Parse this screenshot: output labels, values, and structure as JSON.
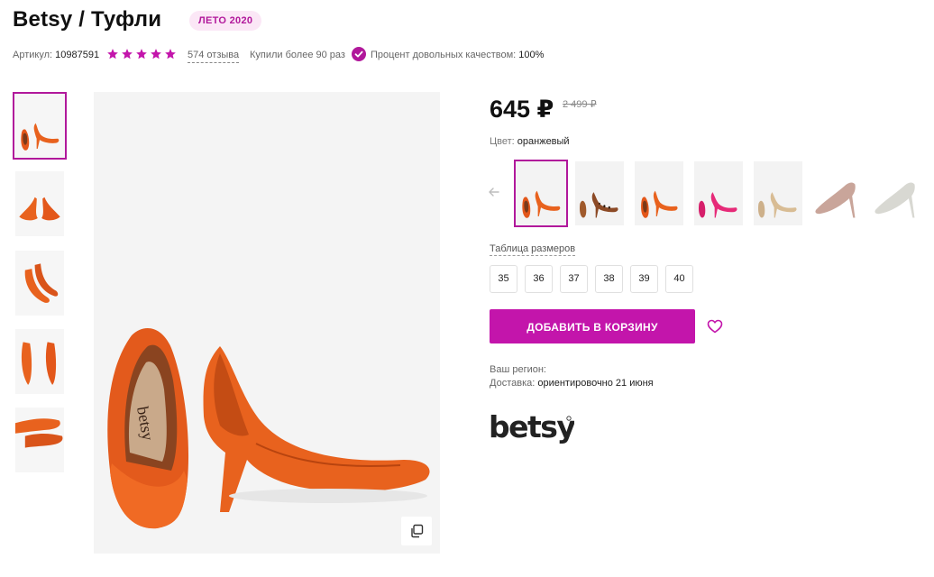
{
  "product": {
    "title": "Betsy / Туфли",
    "badge": "ЛЕТО 2020"
  },
  "meta": {
    "article_label": "Артикул:",
    "article_value": "10987591",
    "rating_stars": 5,
    "reviews": "574 отзыва",
    "purchases": "Купили более 90 раз",
    "quality_label": "Процент довольных качеством:",
    "quality_value": "100%"
  },
  "price": {
    "current": "645 ₽",
    "old": "2 499 ₽"
  },
  "color": {
    "label": "Цвет:",
    "value": "оранжевый"
  },
  "swatches": [
    {
      "color": "orange",
      "selected": true
    },
    {
      "color": "leopard",
      "selected": false
    },
    {
      "color": "orange",
      "selected": false
    },
    {
      "color": "pink",
      "selected": false
    },
    {
      "color": "beige",
      "selected": false
    },
    {
      "color": "dusty-rose",
      "selected": false
    },
    {
      "color": "light-grey",
      "selected": false
    }
  ],
  "sizes": {
    "table_label": "Таблица размеров",
    "items": [
      "35",
      "36",
      "37",
      "38",
      "39",
      "40"
    ]
  },
  "cart": {
    "button_label": "ДОБАВИТЬ В КОРЗИНУ"
  },
  "delivery": {
    "region_label": "Ваш регион:",
    "delivery_label": "Доставка:",
    "delivery_value": "ориентировочно 21 июня"
  },
  "brand": {
    "logo_text": "betsy"
  },
  "colors": {
    "accent": "#c315ab",
    "shoe_orange": "#e8621e",
    "star": "#c315ab"
  }
}
